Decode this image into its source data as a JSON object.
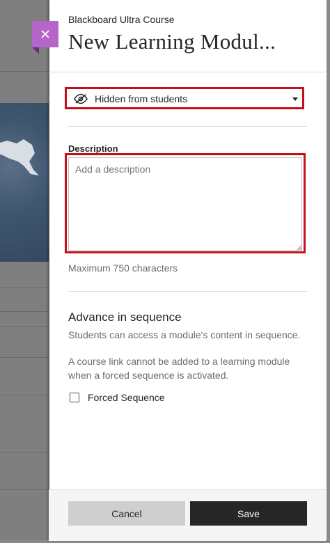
{
  "header": {
    "course_name": "Blackboard Ultra Course",
    "title": "New Learning Modul..."
  },
  "visibility": {
    "label": "Hidden from students",
    "icon": "eye-slash-icon"
  },
  "description": {
    "label": "Description",
    "placeholder": "Add a description",
    "value": "",
    "max_hint": "Maximum 750 characters"
  },
  "sequence": {
    "title": "Advance in sequence",
    "description": "Students can access a module's content in sequence.",
    "note": "A course link cannot be added to a learning module when a forced sequence is activated.",
    "forced_label": "Forced Sequence",
    "forced_checked": false
  },
  "footer": {
    "cancel_label": "Cancel",
    "save_label": "Save"
  },
  "colors": {
    "accent_purple": "#b565c9",
    "highlight_red": "#c3101a",
    "primary_button": "#262626",
    "secondary_button": "#cfcfcf"
  }
}
